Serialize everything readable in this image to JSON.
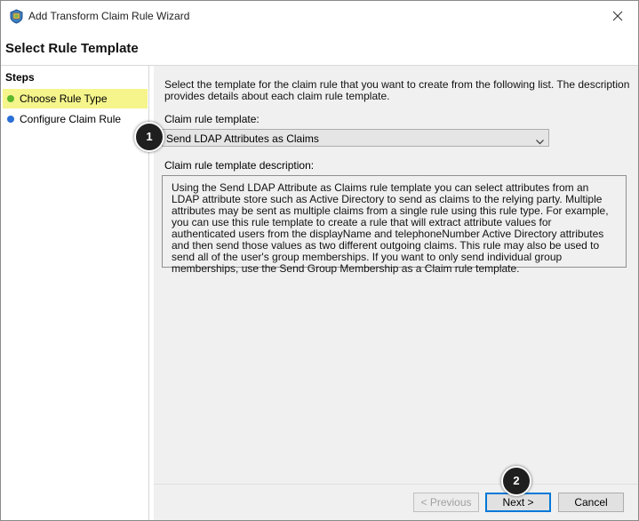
{
  "window": {
    "title": "Add Transform Claim Rule Wizard"
  },
  "header": {
    "title": "Select Rule Template"
  },
  "sidebar": {
    "title": "Steps",
    "items": [
      {
        "label": "Choose Rule Type",
        "state": "active",
        "dot_color": "#5cb82a"
      },
      {
        "label": "Configure Claim Rule",
        "state": "pending",
        "dot_color": "#2b6fd8"
      }
    ]
  },
  "main": {
    "intro": "Select the template for the claim rule that you want to create from the following list. The description provides details about each claim rule template.",
    "template_label": "Claim rule template:",
    "template_value": "Send LDAP Attributes as Claims",
    "description_label": "Claim rule template description:",
    "description": "Using the Send LDAP Attribute as Claims rule template you can select attributes from an LDAP attribute store such as Active Directory to send as claims to the relying party. Multiple attributes may be sent as multiple claims from a single rule using this rule type. For example, you can use this rule template to create a rule that will extract attribute values for authenticated users from the displayName and telephoneNumber Active Directory attributes and then send those values as two different outgoing claims. This rule may also be used to send all of the user's group memberships. If you want to only send individual group memberships, use the Send Group Membership as a Claim rule template."
  },
  "footer": {
    "previous_label": "< Previous",
    "next_label": "Next >",
    "cancel_label": "Cancel"
  },
  "annotations": {
    "badge1": "1",
    "badge2": "2"
  },
  "colors": {
    "accent": "#0078d7",
    "highlight": "#f5f58c"
  }
}
